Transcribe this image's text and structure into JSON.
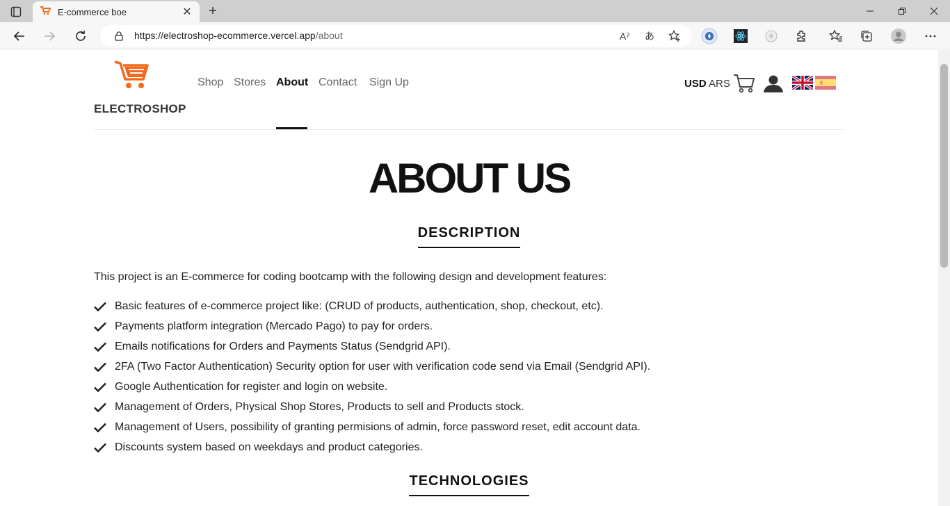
{
  "browser": {
    "tab_title": "E-commerce boe",
    "url_host": "https://electroshop-ecommerce.vercel.app",
    "url_path": "/about"
  },
  "header": {
    "brand": "ELECTROSHOP",
    "nav": [
      {
        "label": "Shop"
      },
      {
        "label": "Stores"
      },
      {
        "label": "About"
      },
      {
        "label": "Contact"
      },
      {
        "label": "Sign Up"
      }
    ],
    "active_nav": "About",
    "currency": {
      "primary": "USD",
      "secondary": "ARS"
    },
    "accent_color": "#f26b1d"
  },
  "main": {
    "title": "ABOUT US",
    "description_heading": "DESCRIPTION",
    "intro": "This project is an E-commerce for coding bootcamp with the following design and development features:",
    "features": [
      "Basic features of e-commerce project like: (CRUD of products, authentication, shop, checkout, etc).",
      "Payments platform integration (Mercado Pago) to pay for orders.",
      "Emails notifications for Orders and Payments Status (Sendgrid API).",
      "2FA (Two Factor Authentication) Security option for user with verification code send via Email (Sendgrid API).",
      "Google Authentication for register and login on website.",
      "Management of Orders, Physical Shop Stores, Products to sell and Products stock.",
      "Management of Users, possibility of granting permisions of admin, force password reset, edit account data.",
      "Discounts system based on weekdays and product categories."
    ],
    "technologies_heading": "TECHNOLOGIES"
  }
}
